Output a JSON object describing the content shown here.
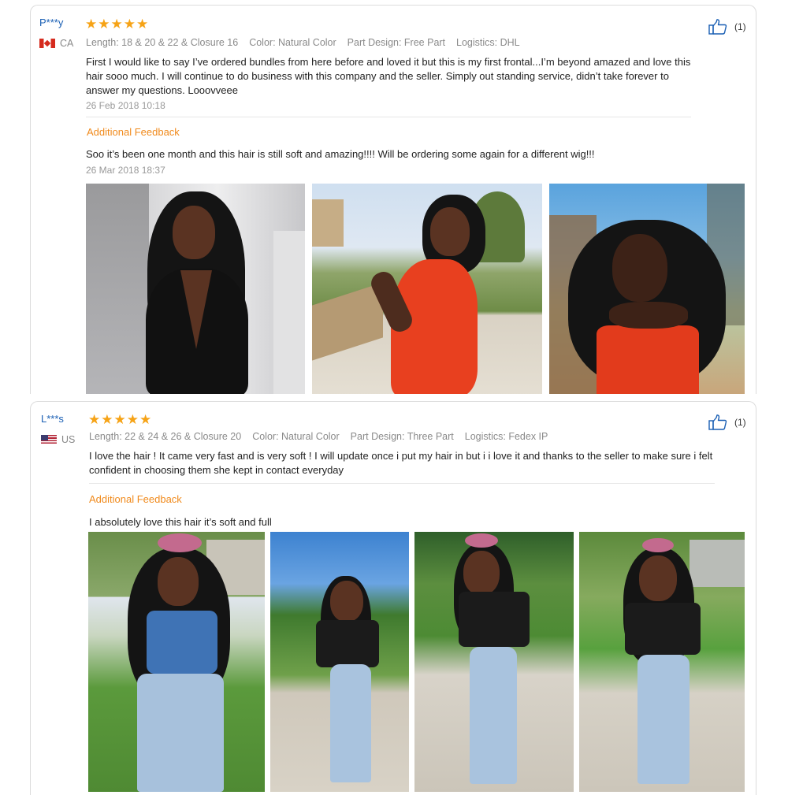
{
  "reviews": [
    {
      "user": "P***y",
      "country": "CA",
      "stars": "★★★★★",
      "meta": [
        "Length: 18 & 20 & 22 & Closure 16",
        "Color: Natural Color",
        "Part Design: Free Part",
        "Logistics: DHL"
      ],
      "text": "First I would like to say I’ve ordered bundles from here before and loved it but this is my first frontal...I’m beyond amazed and love this hair sooo much. I will continue to do business with this company and the seller. Simply out standing service, didn’t take forever to answer my questions. Looovveee",
      "date": "26 Feb 2018 10:18",
      "likes": "(1)",
      "additional_label": "Additional Feedback",
      "additional_text": "Soo it’s been one month and this hair is still soft and amazing!!!! Will be ordering some again for a different wig!!!",
      "additional_date": "26 Mar 2018 18:37",
      "photo_count": 3
    },
    {
      "user": "L***s",
      "country": "US",
      "stars": "★★★★★",
      "meta": [
        "Length: 22 & 24 & 26 & Closure 20",
        "Color: Natural Color",
        "Part Design: Three Part",
        "Logistics: Fedex IP"
      ],
      "text": "I love the hair ! It came very fast and is very soft ! I will update once i put my hair in but i i love it and thanks to the seller to make sure i felt confident in choosing them she kept in contact everyday",
      "likes": "(1)",
      "additional_label": "Additional Feedback",
      "additional_text": "I absolutely love this hair it’s soft and full",
      "photo_count": 4
    }
  ],
  "icons": {
    "like": "thumbs-up-icon",
    "star": "star-icon"
  },
  "colors": {
    "star": "#f6a316",
    "username": "#1a5fb4",
    "additional": "#f08a1c",
    "meta": "#8a8a8a"
  }
}
